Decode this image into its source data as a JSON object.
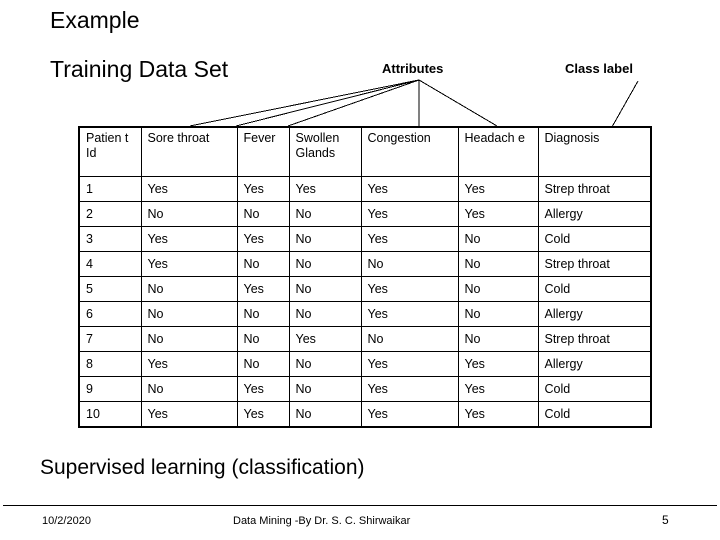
{
  "slide": {
    "title": "Example",
    "subtitle": "Training Data Set",
    "caption": "Supervised learning (classification)"
  },
  "callouts": {
    "attributes": "Attributes",
    "class_label": "Class label"
  },
  "table": {
    "headers": [
      "Patien t Id",
      "Sore throat",
      "Fever",
      "Swollen Glands",
      "Congestion",
      "Headach e",
      "Diagnosis"
    ],
    "rows": [
      [
        "1",
        "Yes",
        "Yes",
        "Yes",
        "Yes",
        "Yes",
        "Strep throat"
      ],
      [
        "2",
        "No",
        "No",
        "No",
        "Yes",
        "Yes",
        "Allergy"
      ],
      [
        "3",
        "Yes",
        "Yes",
        "No",
        "Yes",
        "No",
        "Cold"
      ],
      [
        "4",
        "Yes",
        "No",
        "No",
        "No",
        "No",
        "Strep throat"
      ],
      [
        "5",
        "No",
        "Yes",
        "No",
        "Yes",
        "No",
        "Cold"
      ],
      [
        "6",
        "No",
        "No",
        "No",
        "Yes",
        "No",
        "Allergy"
      ],
      [
        "7",
        "No",
        "No",
        "Yes",
        "No",
        "No",
        "Strep throat"
      ],
      [
        "8",
        "Yes",
        "No",
        "No",
        "Yes",
        "Yes",
        "Allergy"
      ],
      [
        "9",
        "No",
        "Yes",
        "No",
        "Yes",
        "Yes",
        "Cold"
      ],
      [
        "10",
        "Yes",
        "Yes",
        "No",
        "Yes",
        "Yes",
        "Cold"
      ]
    ]
  },
  "footer": {
    "date": "10/2/2020",
    "center": "Data Mining -By Dr. S. C. Shirwaikar",
    "page": "5"
  },
  "colors": {
    "text": "#000000",
    "background": "#ffffff",
    "rule": "#000000"
  }
}
